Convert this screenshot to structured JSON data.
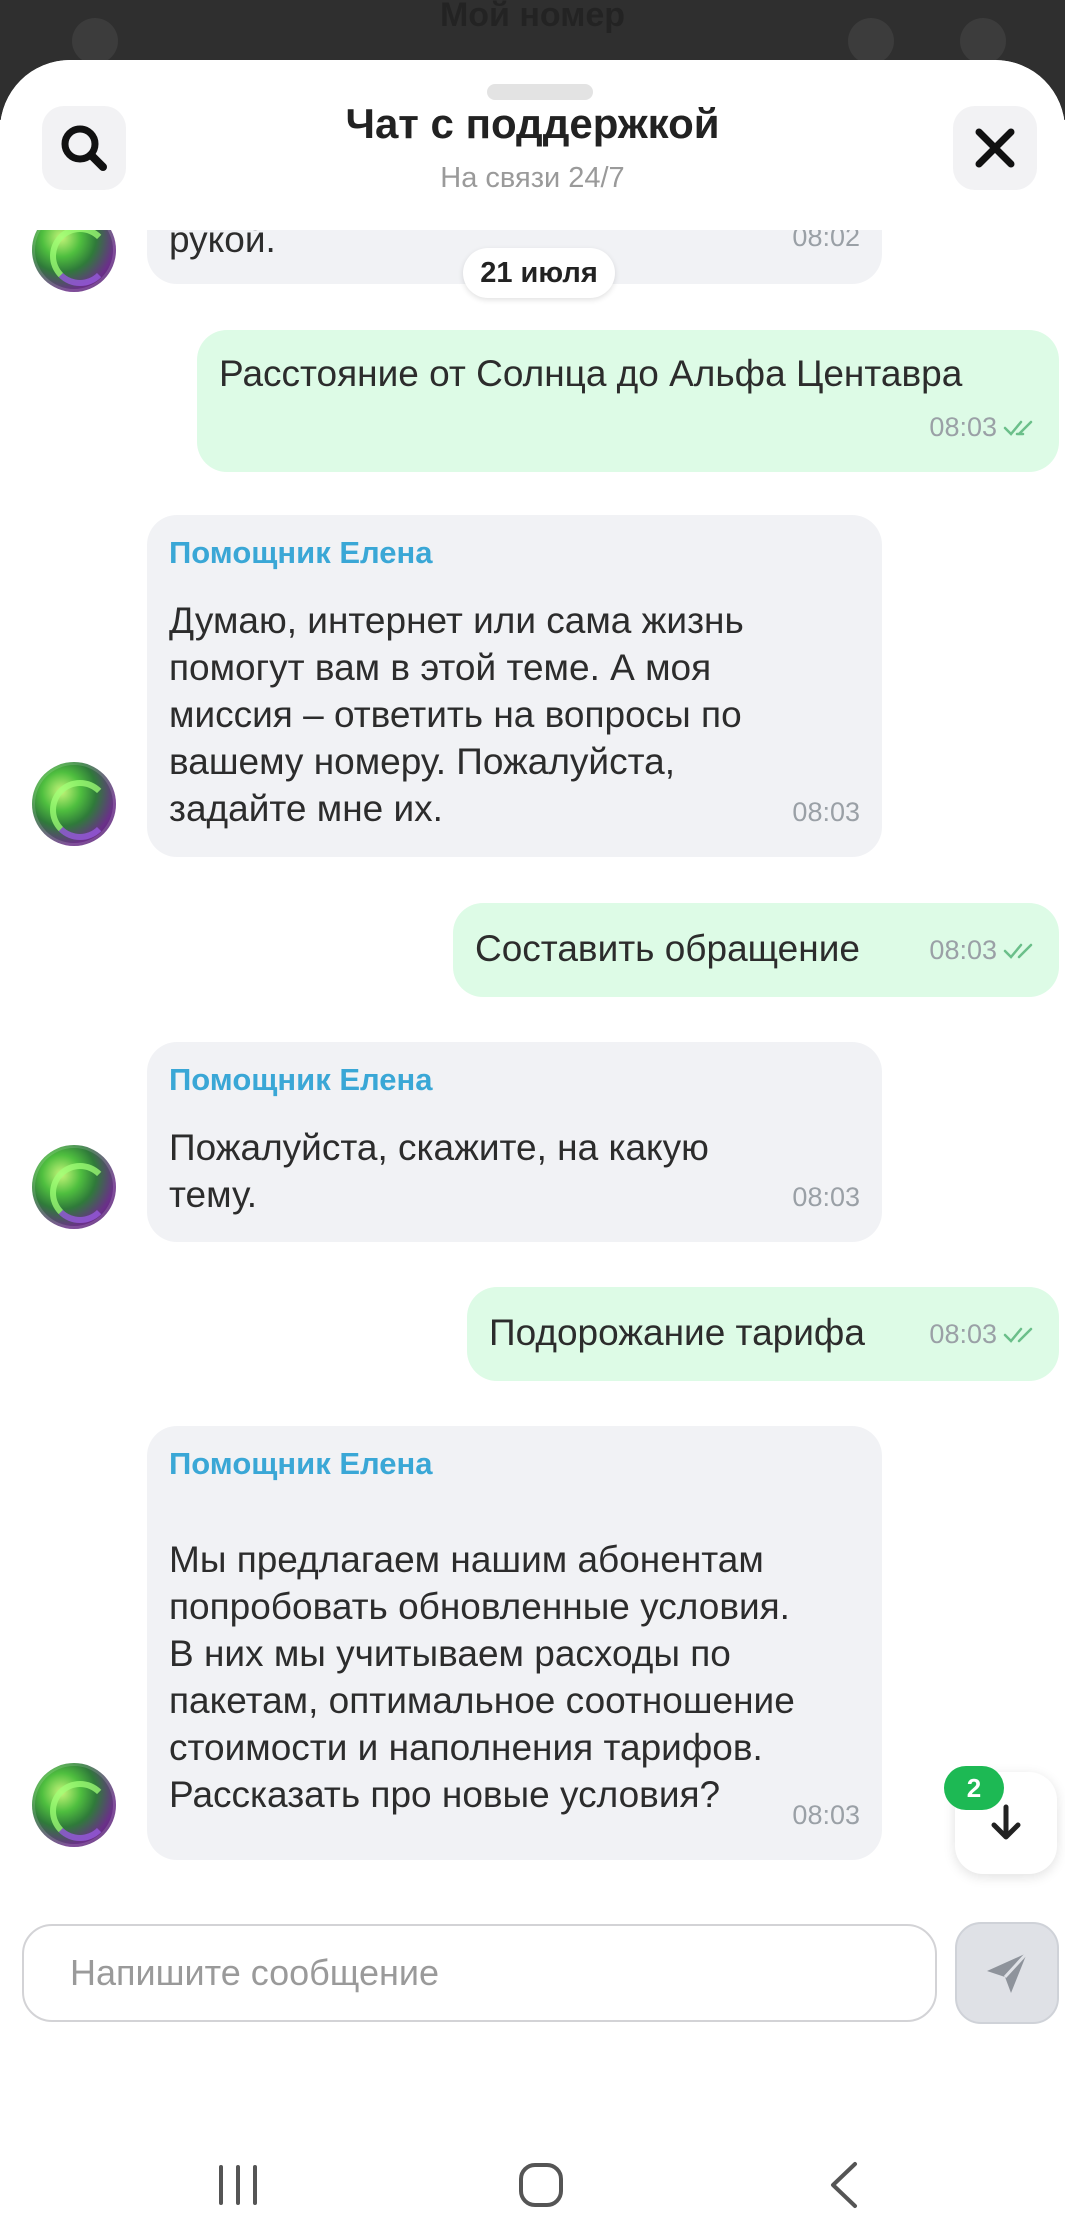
{
  "background_app": {
    "title": "Мой номер",
    "subtitle": ""
  },
  "header": {
    "title": "Чат с поддержкой",
    "subtitle": "На связи 24/7",
    "search_icon": "search-icon",
    "close_icon": "close-icon"
  },
  "date_chip": "21 июля",
  "messages": [
    {
      "side": "bot",
      "sender": "",
      "lines": [
        "рукой."
      ],
      "time": "08:02"
    },
    {
      "side": "user",
      "lines": [
        "Расстояние от Солнца до Альфа Центавра"
      ],
      "time": "08:03"
    },
    {
      "side": "bot",
      "sender": "Помощник Елена",
      "lines": [
        "Думаю, интернет или сама жизнь",
        "помогут вам в этой теме. А моя",
        "миссия – ответить на вопросы по",
        "вашему номеру. Пожалуйста,",
        "задайте мне их."
      ],
      "time": "08:03"
    },
    {
      "side": "user",
      "lines": [
        "Составить обращение"
      ],
      "time": "08:03"
    },
    {
      "side": "bot",
      "sender": "Помощник Елена",
      "lines": [
        "Пожалуйста, скажите, на какую",
        "тему."
      ],
      "time": "08:03"
    },
    {
      "side": "user",
      "lines": [
        "Подорожание тарифа"
      ],
      "time": "08:03"
    },
    {
      "side": "bot",
      "sender": "Помощник Елена",
      "lines": [
        "Мы предлагаем нашим абонентам",
        "попробовать обновленные условия.",
        "В них мы учитываем расходы по",
        "пакетам, оптимальное соотношение",
        "стоимости и наполнения тарифов.",
        "Рассказать про новые условия?"
      ],
      "time": "08:03"
    }
  ],
  "scroll_down": {
    "badge": "2",
    "icon": "arrow-down-icon"
  },
  "composer": {
    "placeholder": "Напишите сообщение",
    "send_icon": "send-icon"
  },
  "navbar": {
    "recent_icon": "recent-apps-icon",
    "home_icon": "home-icon",
    "back_icon": "back-icon"
  },
  "colors": {
    "accent_sender": "#3aa7d6",
    "user_bubble": "#ddfbe6",
    "bot_bubble": "#f1f2f5",
    "badge": "#1db954"
  }
}
